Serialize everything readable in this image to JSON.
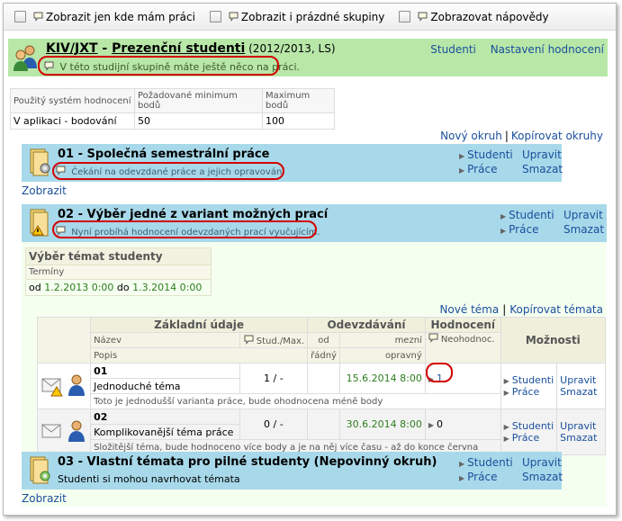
{
  "topbar": {
    "options": [
      {
        "label": "Zobrazit jen kde mám práci"
      },
      {
        "label": "Zobrazit i prázdné skupiny"
      },
      {
        "label": "Zobrazovat nápovědy"
      }
    ]
  },
  "header": {
    "code": "KIV/JXT",
    "dash": " - ",
    "name": "Prezenční studenti",
    "meta": " (2012/2013, LS)",
    "note": "V této studijní skupině máte ještě něco na práci.",
    "link_students": "Studenti",
    "link_settings": "Nastavení hodnocení"
  },
  "info_table": {
    "headers": [
      "Použitý systém hodnocení",
      "Požadované minimum bodů",
      "Maximum bodů"
    ],
    "values": [
      "V aplikaci - bodování",
      "50",
      "100"
    ]
  },
  "top_links": {
    "new": "Nový okruh",
    "sep": "|",
    "copy": "Kopírovat okruhy"
  },
  "sections": [
    {
      "title": "01 - Společná semestrální práce",
      "note": "Čekání na odevzdané práce a jejich opravování",
      "links": [
        "Studenti",
        "Upravit",
        "Práce",
        "Smazat"
      ],
      "show": "Zobrazit"
    },
    {
      "title": "02 - Výběr jedné z variant možných prací",
      "note": "Nyní probíhá hodnocení odevzdaných prací vyučujícím.",
      "links": [
        "Studenti",
        "Upravit",
        "Práce",
        "Smazat"
      ]
    },
    {
      "title": "03 - Vlastní témata pro pilné studenty (Nepovinný okruh)",
      "note": "Studenti si mohou navrhovat témata",
      "links": [
        "Studenti",
        "Upravit",
        "Práce",
        "Smazat"
      ],
      "show": "Zobrazit"
    }
  ],
  "terms": {
    "title": "Výběr témat studenty",
    "label": "Termíny",
    "from_word": "od",
    "from_date": "1.2.2013",
    "from_time": "0:00",
    "to_word": "do",
    "to_date": "1.3.2014",
    "to_time": "0:00"
  },
  "topic_links": {
    "new": "Nové téma",
    "sep": "|",
    "copy": "Kopírovat témata"
  },
  "topics_table": {
    "group_headers": [
      "Základní údaje",
      "Odevzdávání",
      "Hodnocení",
      "Možnosti"
    ],
    "col_name": "Název",
    "col_desc": "Popis",
    "col_stud": "Stud./Max.",
    "col_from": "od",
    "col_regular": "řádný",
    "col_limit": "mezní",
    "col_corr": "opravný",
    "col_unrated": "Neohodnoc.",
    "rows": [
      {
        "num": "01",
        "name": "Jednoduché téma",
        "stud": "1 / -",
        "limit": "15.6.2014 8:00",
        "unrated": "1",
        "desc": "Toto je jednodušší varianta práce, bude ohodnocena méně body",
        "links": [
          "Studenti",
          "Upravit",
          "Práce",
          "Smazat"
        ]
      },
      {
        "num": "02",
        "name": "Komplikovanější téma práce",
        "stud": "0 / -",
        "limit": "30.6.2014 8:00",
        "unrated": "0",
        "desc": "Složitější téma, bude hodnoceno více body a je na něj více času - až do konce června",
        "links": [
          "Studenti",
          "Upravit",
          "Práce",
          "Smazat"
        ]
      }
    ]
  },
  "colors": {
    "header_bg": "#b8e7a8",
    "section_bg": "#a8d9ea",
    "link": "#1a4f9c",
    "highlight_ring": "#d40000",
    "date_green": "#2e7d1e"
  }
}
